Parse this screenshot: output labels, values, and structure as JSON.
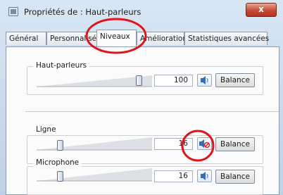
{
  "window": {
    "title": "Propriétés de : Haut-parleurs",
    "close_glyph": "x"
  },
  "tabs": [
    {
      "label": "Général"
    },
    {
      "label": "Personnalisé"
    },
    {
      "label": "Niveaux",
      "active": true
    },
    {
      "label": "Améliorations"
    },
    {
      "label": "Statistiques avancées"
    }
  ],
  "levels": [
    {
      "label": "Haut-parleurs",
      "value": "100",
      "muted": false,
      "balance": "Balance",
      "slider_fraction": 1.0
    },
    {
      "label": "Ligne",
      "value": "16",
      "muted": true,
      "balance": "Balance",
      "slider_fraction": 0.16
    },
    {
      "label": "Microphone",
      "value": "16",
      "muted": false,
      "balance": "Balance",
      "slider_fraction": 0.16
    }
  ],
  "annotation_color": "#e0141a",
  "icons": [
    "speaker-icon",
    "speaker-muted-icon",
    "close-icon"
  ]
}
